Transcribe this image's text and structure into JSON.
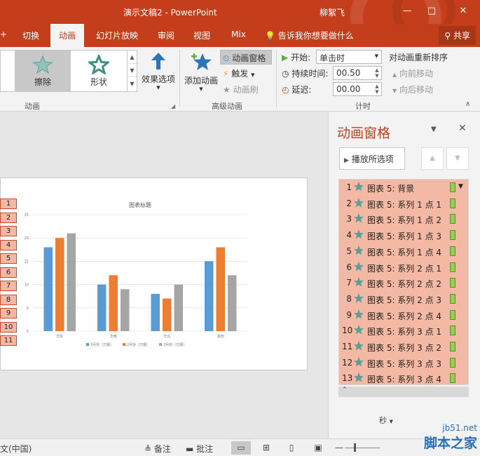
{
  "window": {
    "title": "演示文稿2 - PowerPoint",
    "user": "柳絮飞",
    "minimize": "—",
    "restore": "□",
    "close": "✕"
  },
  "tabs": {
    "items": [
      "切换",
      "动画",
      "幻灯片放映",
      "审阅",
      "视图",
      "Mix"
    ],
    "active": "动画",
    "tell_me": "告诉我你想要做什么",
    "share": "共享",
    "partial_left": "+"
  },
  "ribbon": {
    "animation_gallery": [
      "擦除",
      "形状"
    ],
    "effect_options": "效果选项",
    "group_animation": "动画",
    "add_animation": "添加动画",
    "animation_pane": "动画窗格",
    "trigger": "触发",
    "animation_painter": "动画刷",
    "group_advanced": "高级动画",
    "start_label": "开始:",
    "start_value": "单击时",
    "duration_label": "持续时间:",
    "duration_value": "00.50",
    "delay_label": "延迟:",
    "delay_value": "00.00",
    "group_timing": "计时",
    "reorder_title": "对动画重新排序",
    "move_earlier": "向前移动",
    "move_later": "向后移动"
  },
  "slide": {
    "markers": [
      "1",
      "2",
      "3",
      "4",
      "5",
      "6",
      "7",
      "8",
      "9",
      "10",
      "11"
    ]
  },
  "chart_data": {
    "type": "bar",
    "title": "图表标题",
    "categories": [
      "华东",
      "华南",
      "华北",
      "其他"
    ],
    "series": [
      {
        "name": "1月份（万报）",
        "values": [
          18,
          10,
          8,
          15
        ],
        "color": "#5b9bd5"
      },
      {
        "name": "2月份（万报）",
        "values": [
          20,
          12,
          7,
          18
        ],
        "color": "#ed7d31"
      },
      {
        "name": "3月份（万报）",
        "values": [
          21,
          9,
          10,
          12
        ],
        "color": "#a5a5a5"
      }
    ],
    "yticks": [
      0,
      5,
      10,
      15,
      20,
      25
    ],
    "ylim": [
      0,
      25
    ],
    "grid": true,
    "legend": "bottom"
  },
  "pane": {
    "title": "动画窗格",
    "play_selected": "播放所选项",
    "items": [
      "图表 5: 背景",
      "图表 5: 系列 1 点 1",
      "图表 5: 系列 1 点 2",
      "图表 5: 系列 1 点 3",
      "图表 5: 系列 1 点 4",
      "图表 5: 系列 2 点 1",
      "图表 5: 系列 2 点 2",
      "图表 5: 系列 2 点 3",
      "图表 5: 系列 2 点 4",
      "图表 5: 系列 3 点 1",
      "图表 5: 系列 3 点 2",
      "图表 5: 系列 3 点 3",
      "图表 5: 系列 3 点 4"
    ],
    "seconds": "秒"
  },
  "status": {
    "language": "文(中国)",
    "notes": "备注",
    "comments": "批注"
  },
  "watermark": {
    "site": "jb51.net",
    "brand": "脚本之家"
  },
  "colors": {
    "accent": "#c43e1c",
    "item_highlight": "#f4b9a4",
    "star": "#5f9e96",
    "timeline_bar": "#92d050"
  }
}
